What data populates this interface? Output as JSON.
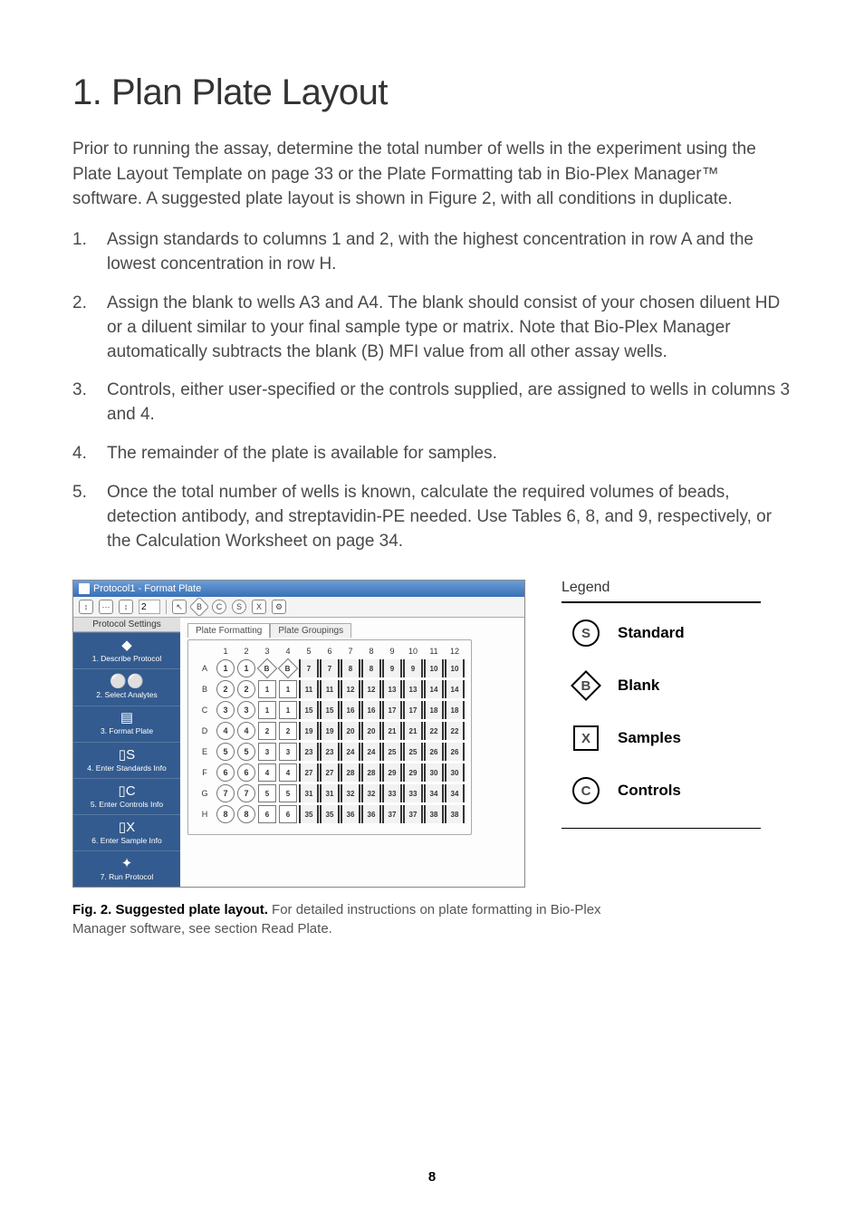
{
  "title": "1. Plan Plate Layout",
  "intro_html": "Prior to running the assay, determine the total number of wells in the experiment using the Plate Layout Template on page 33 or the Plate Formatting tab in Bio-Plex Manager™ software. A suggested plate layout is shown in Figure 2, with all conditions in duplicate.",
  "steps": [
    "Assign standards to columns 1 and 2, with the highest concentration in row A and the lowest concentration in row H.",
    "Assign the blank to wells A3 and A4. The blank should consist of your chosen diluent HD or a diluent similar to your final sample type or matrix. Note that Bio-Plex Manager automatically subtracts the blank (B) MFI value from all other assay wells.",
    "Controls, either user-specified or the controls supplied, are assigned to wells in columns 3 and 4.",
    "The remainder of the plate is available for samples.",
    "Once the total number of wells is known, calculate the required volumes of beads, detection antibody, and streptavidin-PE needed. Use Tables 6, 8, and 9, respectively, or the Calculation Worksheet on page 34."
  ],
  "screenshot": {
    "window_title": "Protocol1 - Format Plate",
    "toolbar": {
      "spinner_value": "2",
      "icons": [
        "B",
        "C",
        "S",
        "X",
        "✕",
        "⚙"
      ]
    },
    "sidebar": {
      "tab": "Protocol Settings",
      "items": [
        {
          "icon": "◆",
          "label": "1. Describe Protocol"
        },
        {
          "icon": "⚪⚪",
          "label": "2. Select Analytes"
        },
        {
          "icon": "▤",
          "label": "3. Format Plate"
        },
        {
          "icon": "▯S",
          "label": "4. Enter Standards Info"
        },
        {
          "icon": "▯C",
          "label": "5. Enter Controls Info"
        },
        {
          "icon": "▯X",
          "label": "6. Enter Sample Info"
        },
        {
          "icon": "✦",
          "label": "7. Run Protocol"
        }
      ]
    },
    "subtabs": [
      "Plate Formatting",
      "Plate Groupings"
    ],
    "plate": {
      "cols": [
        "1",
        "2",
        "3",
        "4",
        "5",
        "6",
        "7",
        "8",
        "9",
        "10",
        "11",
        "12"
      ],
      "rows": [
        "A",
        "B",
        "C",
        "D",
        "E",
        "F",
        "G",
        "H"
      ],
      "cells": [
        [
          {
            "t": "std",
            "v": "1"
          },
          {
            "t": "std",
            "v": "1"
          },
          {
            "t": "blank",
            "v": "B"
          },
          {
            "t": "blank",
            "v": "B"
          },
          {
            "t": "samp",
            "v": "7"
          },
          {
            "t": "samp",
            "v": "7"
          },
          {
            "t": "samp",
            "v": "8"
          },
          {
            "t": "samp",
            "v": "8"
          },
          {
            "t": "samp",
            "v": "9"
          },
          {
            "t": "samp",
            "v": "9"
          },
          {
            "t": "samp",
            "v": "10"
          },
          {
            "t": "samp",
            "v": "10"
          }
        ],
        [
          {
            "t": "std",
            "v": "2"
          },
          {
            "t": "std",
            "v": "2"
          },
          {
            "t": "ctrl",
            "v": "1"
          },
          {
            "t": "ctrl",
            "v": "1"
          },
          {
            "t": "samp",
            "v": "11"
          },
          {
            "t": "samp",
            "v": "11"
          },
          {
            "t": "samp",
            "v": "12"
          },
          {
            "t": "samp",
            "v": "12"
          },
          {
            "t": "samp",
            "v": "13"
          },
          {
            "t": "samp",
            "v": "13"
          },
          {
            "t": "samp",
            "v": "14"
          },
          {
            "t": "samp",
            "v": "14"
          }
        ],
        [
          {
            "t": "std",
            "v": "3"
          },
          {
            "t": "std",
            "v": "3"
          },
          {
            "t": "ctrl",
            "v": "1"
          },
          {
            "t": "ctrl",
            "v": "1"
          },
          {
            "t": "samp",
            "v": "15"
          },
          {
            "t": "samp",
            "v": "15"
          },
          {
            "t": "samp",
            "v": "16"
          },
          {
            "t": "samp",
            "v": "16"
          },
          {
            "t": "samp",
            "v": "17"
          },
          {
            "t": "samp",
            "v": "17"
          },
          {
            "t": "samp",
            "v": "18"
          },
          {
            "t": "samp",
            "v": "18"
          }
        ],
        [
          {
            "t": "std",
            "v": "4"
          },
          {
            "t": "std",
            "v": "4"
          },
          {
            "t": "ctrl",
            "v": "2"
          },
          {
            "t": "ctrl",
            "v": "2"
          },
          {
            "t": "samp",
            "v": "19"
          },
          {
            "t": "samp",
            "v": "19"
          },
          {
            "t": "samp",
            "v": "20"
          },
          {
            "t": "samp",
            "v": "20"
          },
          {
            "t": "samp",
            "v": "21"
          },
          {
            "t": "samp",
            "v": "21"
          },
          {
            "t": "samp",
            "v": "22"
          },
          {
            "t": "samp",
            "v": "22"
          }
        ],
        [
          {
            "t": "std",
            "v": "5"
          },
          {
            "t": "std",
            "v": "5"
          },
          {
            "t": "ctrl",
            "v": "3"
          },
          {
            "t": "ctrl",
            "v": "3"
          },
          {
            "t": "samp",
            "v": "23"
          },
          {
            "t": "samp",
            "v": "23"
          },
          {
            "t": "samp",
            "v": "24"
          },
          {
            "t": "samp",
            "v": "24"
          },
          {
            "t": "samp",
            "v": "25"
          },
          {
            "t": "samp",
            "v": "25"
          },
          {
            "t": "samp",
            "v": "26"
          },
          {
            "t": "samp",
            "v": "26"
          }
        ],
        [
          {
            "t": "std",
            "v": "6"
          },
          {
            "t": "std",
            "v": "6"
          },
          {
            "t": "ctrl",
            "v": "4"
          },
          {
            "t": "ctrl",
            "v": "4"
          },
          {
            "t": "samp",
            "v": "27"
          },
          {
            "t": "samp",
            "v": "27"
          },
          {
            "t": "samp",
            "v": "28"
          },
          {
            "t": "samp",
            "v": "28"
          },
          {
            "t": "samp",
            "v": "29"
          },
          {
            "t": "samp",
            "v": "29"
          },
          {
            "t": "samp",
            "v": "30"
          },
          {
            "t": "samp",
            "v": "30"
          }
        ],
        [
          {
            "t": "std",
            "v": "7"
          },
          {
            "t": "std",
            "v": "7"
          },
          {
            "t": "ctrl",
            "v": "5"
          },
          {
            "t": "ctrl",
            "v": "5"
          },
          {
            "t": "samp",
            "v": "31"
          },
          {
            "t": "samp",
            "v": "31"
          },
          {
            "t": "samp",
            "v": "32"
          },
          {
            "t": "samp",
            "v": "32"
          },
          {
            "t": "samp",
            "v": "33"
          },
          {
            "t": "samp",
            "v": "33"
          },
          {
            "t": "samp",
            "v": "34"
          },
          {
            "t": "samp",
            "v": "34"
          }
        ],
        [
          {
            "t": "std",
            "v": "8"
          },
          {
            "t": "std",
            "v": "8"
          },
          {
            "t": "ctrl",
            "v": "6"
          },
          {
            "t": "ctrl",
            "v": "6"
          },
          {
            "t": "samp",
            "v": "35"
          },
          {
            "t": "samp",
            "v": "35"
          },
          {
            "t": "samp",
            "v": "36"
          },
          {
            "t": "samp",
            "v": "36"
          },
          {
            "t": "samp",
            "v": "37"
          },
          {
            "t": "samp",
            "v": "37"
          },
          {
            "t": "samp",
            "v": "38"
          },
          {
            "t": "samp",
            "v": "38"
          }
        ]
      ]
    }
  },
  "legend": {
    "title": "Legend",
    "items": [
      {
        "sym": "S",
        "shape": "circle",
        "label": "Standard"
      },
      {
        "sym": "B",
        "shape": "diam",
        "label": "Blank"
      },
      {
        "sym": "X",
        "shape": "sq",
        "label": "Samples"
      },
      {
        "sym": "C",
        "shape": "circle",
        "label": "Controls"
      }
    ]
  },
  "caption_bold": "Fig. 2. Suggested plate layout.",
  "caption_rest": " For detailed instructions on plate formatting in Bio-Plex Manager software, see section Read Plate.",
  "page_number": "8"
}
